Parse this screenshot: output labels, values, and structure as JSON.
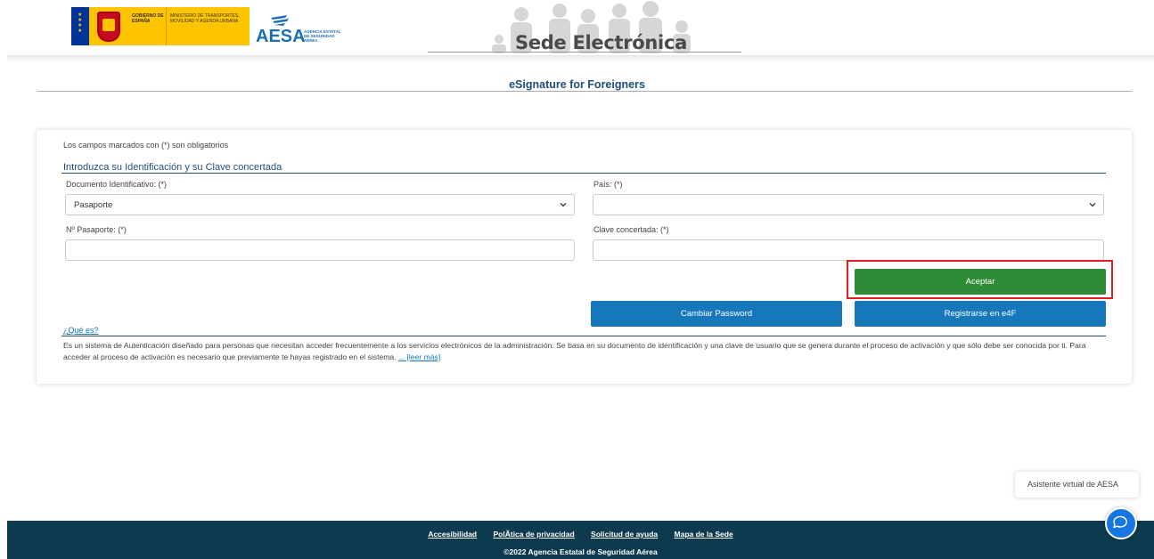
{
  "header": {
    "gov_text_1": "GOBIERNO DE ESPAÑA",
    "gov_text_2": "MINISTERIO DE TRANSPORTES, MOVILIDAD Y AGENDA URBANA",
    "aesa_mark": "AESA",
    "aesa_subtitle": "AGENCIA ESTATAL DE SEGURIDAD AÉREA",
    "sede_title": "Sede Electrónica"
  },
  "page": {
    "title": "eSignature for Foreigners"
  },
  "form": {
    "required_note": "Los campos marcados con (*) son obligatorios",
    "section_title": "Introduzca su Identificación y su Clave concertada",
    "documento_label": "Documento Identificativo: (*)",
    "documento_value": "Pasaporte",
    "pais_label": "País: (*)",
    "pais_value": "",
    "pasaporte_label": "Nº Pasaporte: (*)",
    "pasaporte_value": "",
    "clave_label": "Clave concertada: (*)",
    "clave_value": "",
    "aceptar_label": "Aceptar",
    "cambiar_label": "Cambiar Password",
    "registrarse_label": "Registrarse en e4F"
  },
  "info": {
    "que_es": "¿Qué es?",
    "description": "Es un sistema de Autenticación diseñado para personas que necesitan acceder frecuentemente a los servicios electrónicos de la administración. Se basa en su documento de identificación y una clave de usuario que se genera durante el proceso de activación y que sólo debe ser conocida por ti. Para acceder al proceso de activación es necesario que previamente te hayas registrado en el sistema.",
    "leer_mas": "... [leer más]"
  },
  "chat": {
    "label": "Asistente virtual de AESA",
    "icon": "chat-icon"
  },
  "footer": {
    "links": [
      "Accesibilidad",
      "PolÃtica de privacidad",
      "Solicitud de ayuda",
      "Mapa de la Sede"
    ],
    "copyright": "©2022 Agencia Estatal de Seguridad Aérea"
  },
  "colors": {
    "accent_blue": "#1677bb",
    "accept_green": "#2e8b36",
    "footer_bg": "#0d3a4e",
    "title_blue": "#1f4e79",
    "highlight_red": "#e02020"
  }
}
